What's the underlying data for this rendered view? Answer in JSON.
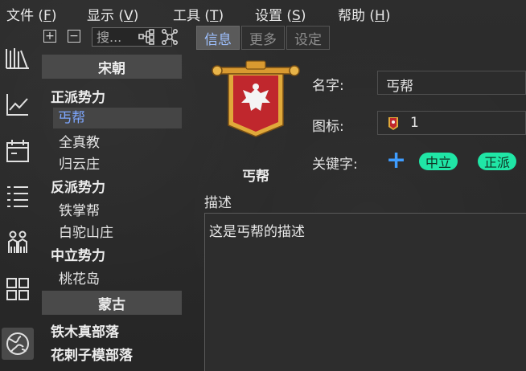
{
  "menu": [
    {
      "label": "文件",
      "key": "F"
    },
    {
      "label": "显示",
      "key": "V"
    },
    {
      "label": "工具",
      "key": "T"
    },
    {
      "label": "设置",
      "key": "S"
    },
    {
      "label": "帮助",
      "key": "H"
    }
  ],
  "sidebar_icons": [
    "library-icon",
    "chart-line-icon",
    "calendar-icon",
    "list-icon",
    "people-icon",
    "grid-icon",
    "globe-icon"
  ],
  "tree_toolbar": {
    "expand": "+",
    "collapse": "−",
    "search_placeholder": "搜...",
    "icons": [
      "hierarchy-icon",
      "network-icon"
    ]
  },
  "tree": {
    "group1": "宋朝",
    "cat1": "正派势力",
    "cat1_items": [
      "丐帮",
      "全真教",
      "归云庄"
    ],
    "cat2": "反派势力",
    "cat2_items": [
      "铁掌帮",
      "白驼山庄"
    ],
    "cat3": "中立势力",
    "cat3_items": [
      "桃花岛"
    ],
    "group2": "蒙古",
    "group2_items": [
      "铁木真部落",
      "花剌子模部落"
    ]
  },
  "tabs": [
    "信息",
    "更多",
    "设定"
  ],
  "detail": {
    "entity_name": "丐帮",
    "name_label": "名字:",
    "name_value": "丐帮",
    "icon_label": "图标:",
    "icon_value": "1",
    "keywords_label": "关键字:",
    "add_symbol": "+",
    "tags": [
      "中立",
      "正派"
    ],
    "desc_label": "描述",
    "desc_value": "这是丐帮的描述"
  },
  "colors": {
    "accent": "#7ea7ff",
    "tag": "#20e6a6",
    "plus": "#3f9dff",
    "banner_red": "#c0272d",
    "banner_gold": "#e0a93a"
  }
}
